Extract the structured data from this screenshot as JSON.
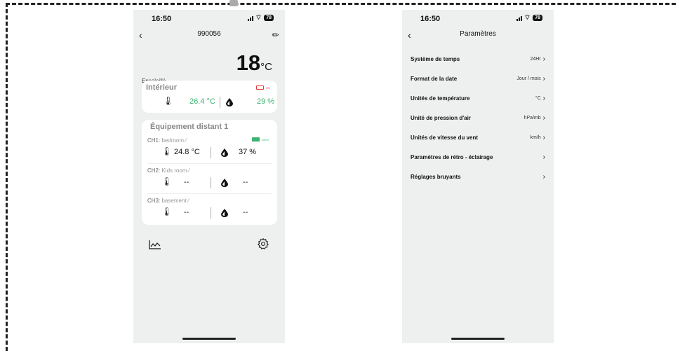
{
  "left_screen": {
    "status_time": "16:50",
    "battery": "78",
    "title": "990056",
    "temperature": "18",
    "temperature_unit": "°C",
    "weather": "Ensoleillé",
    "indoor": {
      "title": "Intérieur",
      "battery_pct": "0%",
      "temp": "26.4 °C",
      "humidity": "29 %"
    },
    "remote": {
      "title": "Équipement distant 1",
      "battery_pct": "100%",
      "channels": [
        {
          "id": "CH1:",
          "room": "bedroom",
          "temp": "24.8 °C",
          "humidity": "37 %"
        },
        {
          "id": "CH2:",
          "room": "Kids room",
          "temp": "--",
          "humidity": "--"
        },
        {
          "id": "CH3:",
          "room": "basement",
          "temp": "--",
          "humidity": "--"
        }
      ]
    }
  },
  "right_screen": {
    "status_time": "16:50",
    "battery": "78",
    "title": "Paramètres",
    "items": [
      {
        "label": "Système de temps",
        "value": "24Hr"
      },
      {
        "label": "Format de la date",
        "value": "Jour / mois"
      },
      {
        "label": "Unités de température",
        "value": "°C"
      },
      {
        "label": "Unité de pression d'air",
        "value": "hPa/mb"
      },
      {
        "label": "Unités de vitesse du vent",
        "value": "km/h"
      },
      {
        "label": "Paramètres de rétro - éclairage",
        "value": ""
      },
      {
        "label": "Réglages bruyants",
        "value": ""
      }
    ]
  },
  "icons": {
    "back": "chevron-left-icon",
    "edit": "pencil-icon",
    "thermometer": "thermometer-icon",
    "humidity": "drop-icon",
    "history": "line-chart-icon",
    "settings": "gear-icon"
  },
  "colors": {
    "accent_green": "#3cb371",
    "battery_low": "#e63b3b",
    "screen_bg": "#eef0ef"
  }
}
